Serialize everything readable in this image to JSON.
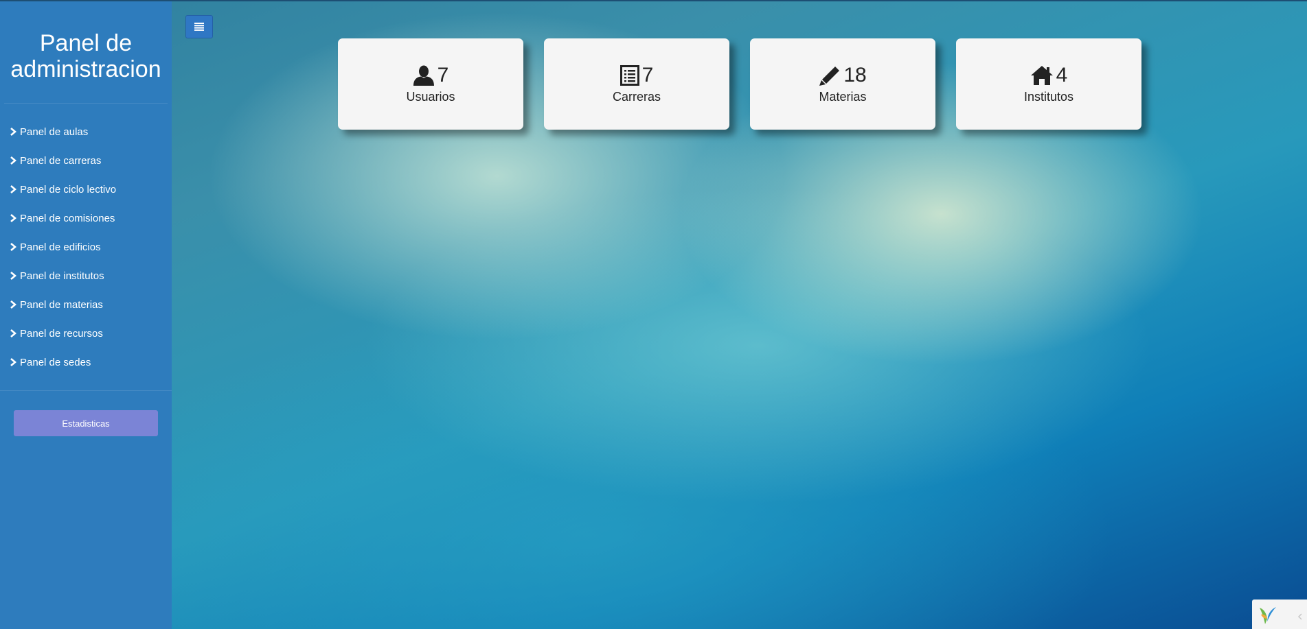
{
  "sidebar": {
    "title": "Panel de administracion",
    "items": [
      {
        "label": "Panel de aulas"
      },
      {
        "label": "Panel de carreras"
      },
      {
        "label": "Panel de ciclo lectivo"
      },
      {
        "label": "Panel de comisiones"
      },
      {
        "label": "Panel de edificios"
      },
      {
        "label": "Panel de institutos"
      },
      {
        "label": "Panel de materias"
      },
      {
        "label": "Panel de recursos"
      },
      {
        "label": "Panel de sedes"
      }
    ],
    "stats_button": "Estadisticas"
  },
  "toolbar": {
    "toggle_icon": "menu-list-icon"
  },
  "cards": [
    {
      "icon": "user-icon",
      "count": "7",
      "label": "Usuarios"
    },
    {
      "icon": "list-icon",
      "count": "7",
      "label": "Carreras"
    },
    {
      "icon": "pencil-icon",
      "count": "18",
      "label": "Materias"
    },
    {
      "icon": "home-icon",
      "count": "4",
      "label": "Institutos"
    }
  ],
  "colors": {
    "sidebar": "#2e7cbd",
    "stats_button": "#7b84d6",
    "card": "#f5f5f5"
  }
}
